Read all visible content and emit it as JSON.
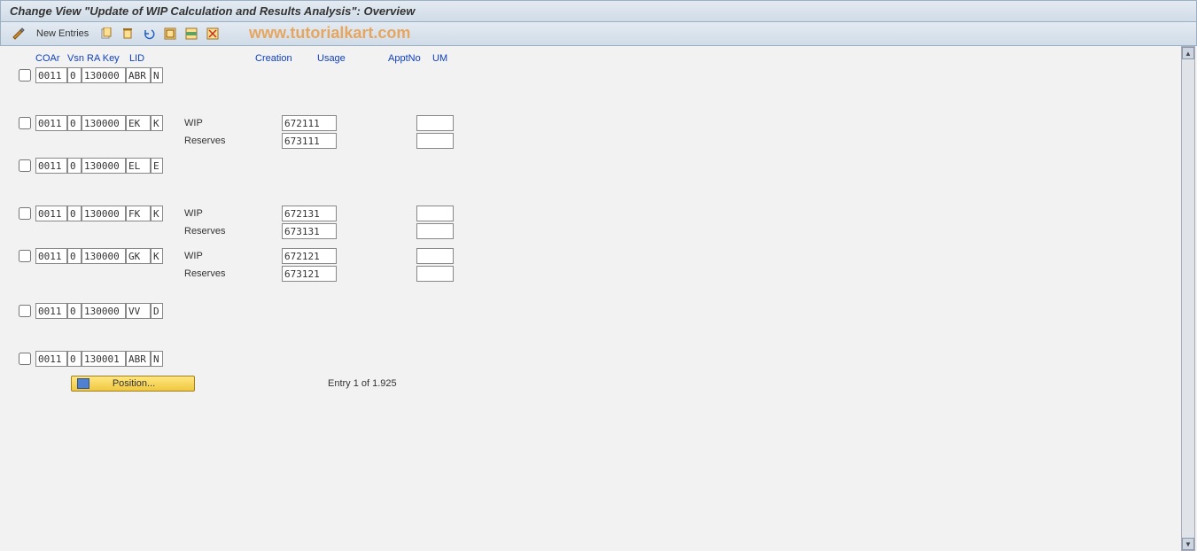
{
  "title": "Change View \"Update of WIP Calculation and Results Analysis\": Overview",
  "toolbar": {
    "new_entries": "New Entries"
  },
  "watermark": "www.tutorialkart.com",
  "headers": {
    "coar": "COAr",
    "vsn": "Vsn",
    "rakey": "RA Key",
    "lid": "LID",
    "creation": "Creation",
    "usage": "Usage",
    "apptno": "ApptNo",
    "um": "UM"
  },
  "labels": {
    "wip": "WIP",
    "reserves": "Reserves"
  },
  "rows": [
    {
      "coar": "0011",
      "vsn": "0",
      "rakey": "130000",
      "lid": "ABR",
      "x": "N",
      "sub": []
    },
    {
      "coar": "0011",
      "vsn": "0",
      "rakey": "130000",
      "lid": "EK",
      "x": "K",
      "sub": [
        {
          "label": "wip",
          "creation": "672111",
          "appt": ""
        },
        {
          "label": "reserves",
          "creation": "673111",
          "appt": ""
        }
      ]
    },
    {
      "coar": "0011",
      "vsn": "0",
      "rakey": "130000",
      "lid": "EL",
      "x": "E",
      "sub": []
    },
    {
      "coar": "0011",
      "vsn": "0",
      "rakey": "130000",
      "lid": "FK",
      "x": "K",
      "sub": [
        {
          "label": "wip",
          "creation": "672131",
          "appt": ""
        },
        {
          "label": "reserves",
          "creation": "673131",
          "appt": ""
        }
      ]
    },
    {
      "coar": "0011",
      "vsn": "0",
      "rakey": "130000",
      "lid": "GK",
      "x": "K",
      "sub": [
        {
          "label": "wip",
          "creation": "672121",
          "appt": ""
        },
        {
          "label": "reserves",
          "creation": "673121",
          "appt": ""
        }
      ]
    },
    {
      "coar": "0011",
      "vsn": "0",
      "rakey": "130000",
      "lid": "VV",
      "x": "D",
      "sub": []
    },
    {
      "coar": "0011",
      "vsn": "0",
      "rakey": "130001",
      "lid": "ABR",
      "x": "N",
      "sub": []
    }
  ],
  "position_button": "Position...",
  "entry_text": "Entry 1 of 1.925"
}
